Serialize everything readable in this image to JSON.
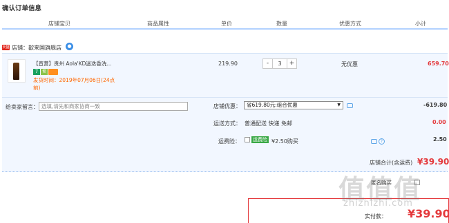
{
  "title": "确认订单信息",
  "columns": [
    "店铺宝贝",
    "商品属性",
    "单价",
    "数量",
    "优惠方式",
    "小计"
  ],
  "shop": {
    "badge": "天猫",
    "name": "歙来国旗舰店",
    "chat_icon": "ww-icon"
  },
  "item": {
    "title": "【直营】贵州 Aola'KD迷迭香洗...",
    "badge_seven": "7",
    "badge_health": "健",
    "ship_time": "发货时间：2019年07月06日(24点前)",
    "price": "219.90",
    "quantity": "3",
    "minus": "-",
    "plus": "+",
    "promotion": "无优惠",
    "subtotal": "659.70"
  },
  "message": {
    "label": "给卖家留言：",
    "placeholder": "选填,请先和商家协商一致"
  },
  "shop_discount": {
    "label": "店铺优惠：",
    "selected": "省619.80元:组合优惠",
    "amount": "-619.80"
  },
  "delivery": {
    "label": "运送方式：",
    "value": "普通配送 快递 免邮",
    "amount": "0.00"
  },
  "insurance": {
    "label": "运费险：",
    "tag": "运费险",
    "text": "¥2.50购买",
    "amount": "2.50"
  },
  "shop_total": {
    "label": "店铺合计(含运费)",
    "value": "¥39.90"
  },
  "anonymous": {
    "label": "匿名购买"
  },
  "actual": {
    "label": "实付款：",
    "value": "¥39.90"
  },
  "watermark": {
    "main": "值值值",
    "sub": "zhizhizhi.com"
  },
  "colors": {
    "accent": "#e4393c",
    "header_border": "#b2d1ff",
    "row_bg": "#f2f7ff",
    "ship_orange": "#ff6600"
  }
}
